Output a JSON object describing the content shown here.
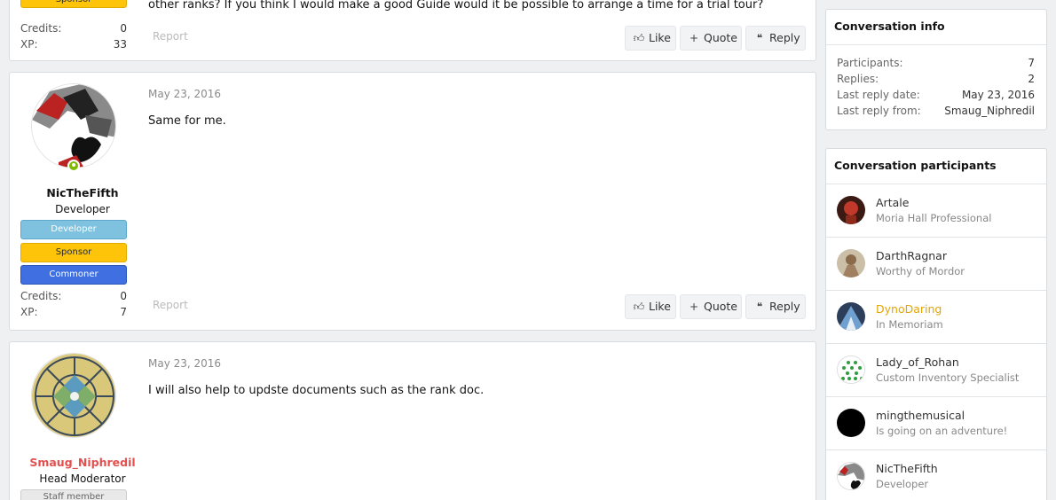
{
  "post0": {
    "sponsor_label": "Sponsor",
    "message_tail": "other ranks? If you think I would make a good Guide would it be possible to arrange a time for a trial tour?",
    "credits_label": "Credits:",
    "credits": "0",
    "xp_label": "XP:",
    "xp": "33",
    "report": "Report",
    "actions": {
      "like": "Like",
      "quote": "Quote",
      "reply": "Reply"
    }
  },
  "post1": {
    "username": "NicTheFifth",
    "user_title": "Developer",
    "banners": [
      "Developer",
      "Sponsor",
      "Commoner"
    ],
    "credits_label": "Credits:",
    "credits": "0",
    "xp_label": "XP:",
    "xp": "7",
    "date": "May 23, 2016",
    "message": "Same for me.",
    "report": "Report",
    "actions": {
      "like": "Like",
      "quote": "Quote",
      "reply": "Reply"
    }
  },
  "post2": {
    "username": "Smaug_Niphredil",
    "user_title": "Head Moderator",
    "banner": "Staff member",
    "date": "May 23, 2016",
    "message": "I will also help to updste documents such as the rank doc."
  },
  "info": {
    "title": "Conversation info",
    "rows": [
      {
        "label": "Participants:",
        "value": "7"
      },
      {
        "label": "Replies:",
        "value": "2"
      },
      {
        "label": "Last reply date:",
        "value": "May 23, 2016"
      },
      {
        "label": "Last reply from:",
        "value": "Smaug_Niphredil"
      }
    ]
  },
  "participants": {
    "title": "Conversation participants",
    "items": [
      {
        "name": "Artale",
        "title": "Moria Hall Professional"
      },
      {
        "name": "DarthRagnar",
        "title": "Worthy of Mordor"
      },
      {
        "name": "DynoDaring",
        "title": "In Memoriam"
      },
      {
        "name": "Lady_of_Rohan",
        "title": "Custom Inventory Specialist"
      },
      {
        "name": "mingthemusical",
        "title": "Is going on an adventure!"
      },
      {
        "name": "NicTheFifth",
        "title": "Developer"
      }
    ]
  },
  "colors": {
    "moderator_name": "#e25050",
    "memoriam_name": "#e5a500",
    "sponsor": "#fdc409",
    "developer_banner": "#7ec2e0",
    "commoner_banner": "#3f6fe0",
    "online": "#7fb900"
  }
}
